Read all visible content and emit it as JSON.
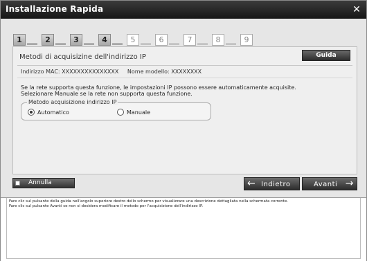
{
  "window": {
    "title": "Installazione Rapida",
    "close_glyph": "✕"
  },
  "steps": [
    {
      "number": "1",
      "state": "done"
    },
    {
      "number": "2",
      "state": "done"
    },
    {
      "number": "3",
      "state": "done"
    },
    {
      "number": "4",
      "state": "current"
    },
    {
      "number": "5",
      "state": "pending"
    },
    {
      "number": "6",
      "state": "pending"
    },
    {
      "number": "7",
      "state": "pending"
    },
    {
      "number": "8",
      "state": "pending"
    },
    {
      "number": "9",
      "state": "pending"
    }
  ],
  "panel": {
    "heading": "Metodi di acquisizine dell'indirizzo IP",
    "guida_label": "Guida",
    "mac_label": "Indirizzo MAC: XXXXXXXXXXXXXXX",
    "model_label": "Nome modello: XXXXXXXX",
    "desc_line1": "Se la rete supporta questa funzione, le impostazioni IP possono essere automaticamente acquisite.",
    "desc_line2": "Selezionare Manuale se la rete non supporta questa funzione.",
    "method_group_label": "Metodo acquisizione indirizzo IP",
    "option_auto": "Automatico",
    "option_manual": "Manuale",
    "selected": "Automatico"
  },
  "toolbar": {
    "annulla_label": "Annulla",
    "indietro_label": "Indietro",
    "avanti_label": "Avanti",
    "left_arrow": "🡐",
    "right_arrow": "🡒"
  },
  "help": {
    "line1": "Fare clic sul pulsante della guida nell'angolo superiore destro dello schermo per visualizzare una descrizione dettagliata nella schermata corrente.",
    "line2": "Fare clic sul pulsante Avanti se non si desidera modificare il metodo per l'acquisizione dell'indirizzo IP."
  },
  "icons": {
    "close": "close-icon",
    "back": "arrow-left-icon",
    "next": "arrow-right-icon"
  }
}
